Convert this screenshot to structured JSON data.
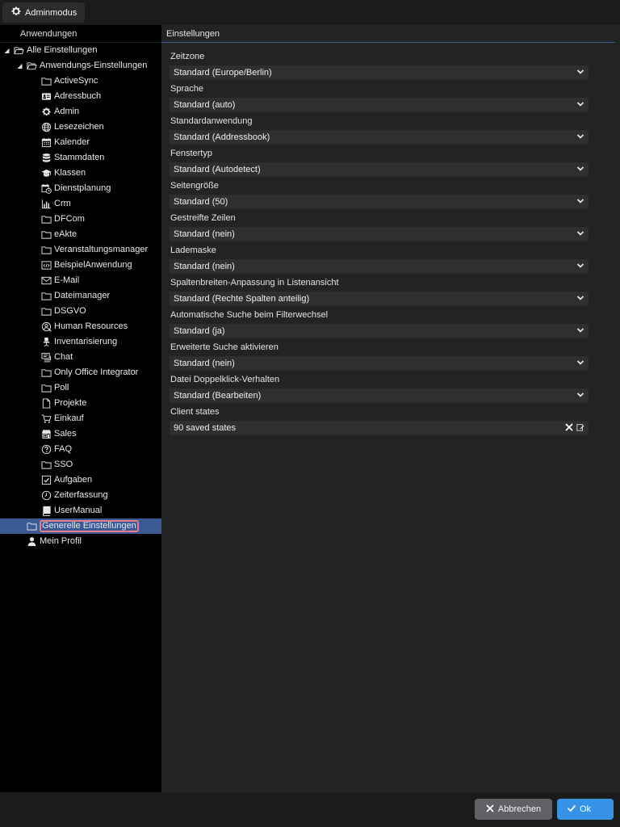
{
  "topbar": {
    "admin_label": "Adminmodus"
  },
  "left": {
    "header": "Anwendungen",
    "tree": [
      {
        "label": "Alle Einstellungen",
        "level": 0,
        "toggle": "expanded",
        "icon": "folder-open-icon"
      },
      {
        "label": "Anwendungs-Einstellungen",
        "level": 1,
        "toggle": "expanded",
        "icon": "folder-open-icon"
      },
      {
        "label": "ActiveSync",
        "level": 2,
        "icon": "folder-icon"
      },
      {
        "label": "Adressbuch",
        "level": 2,
        "icon": "address-card-icon"
      },
      {
        "label": "Admin",
        "level": 2,
        "icon": "gear-icon"
      },
      {
        "label": "Lesezeichen",
        "level": 2,
        "icon": "globe-icon"
      },
      {
        "label": "Kalender",
        "level": 2,
        "icon": "calendar-icon"
      },
      {
        "label": "Stammdaten",
        "level": 2,
        "icon": "database-icon"
      },
      {
        "label": "Klassen",
        "level": 2,
        "icon": "graduation-cap-icon"
      },
      {
        "label": "Dienstplanung",
        "level": 2,
        "icon": "calendar-clock-icon"
      },
      {
        "label": "Crm",
        "level": 2,
        "icon": "bar-chart-icon"
      },
      {
        "label": "DFCom",
        "level": 2,
        "icon": "folder-icon"
      },
      {
        "label": "eAkte",
        "level": 2,
        "icon": "folder-icon"
      },
      {
        "label": "Veranstaltungsmanager",
        "level": 2,
        "icon": "folder-icon"
      },
      {
        "label": "BeispielAnwendung",
        "level": 2,
        "icon": "code-window-icon"
      },
      {
        "label": "E-Mail",
        "level": 2,
        "icon": "envelope-icon"
      },
      {
        "label": "Dateimanager",
        "level": 2,
        "icon": "folder-icon"
      },
      {
        "label": "DSGVO",
        "level": 2,
        "icon": "folder-icon"
      },
      {
        "label": "Human Resources",
        "level": 2,
        "icon": "user-search-icon"
      },
      {
        "label": "Inventarisierung",
        "level": 2,
        "icon": "office-chair-icon"
      },
      {
        "label": "Chat",
        "level": 2,
        "icon": "chat-icon"
      },
      {
        "label": "Only Office Integrator",
        "level": 2,
        "icon": "folder-icon"
      },
      {
        "label": "Poll",
        "level": 2,
        "icon": "folder-icon"
      },
      {
        "label": "Projekte",
        "level": 2,
        "icon": "document-icon"
      },
      {
        "label": "Einkauf",
        "level": 2,
        "icon": "shopping-cart-icon"
      },
      {
        "label": "Sales",
        "level": 2,
        "icon": "store-icon"
      },
      {
        "label": "FAQ",
        "level": 2,
        "icon": "question-circle-icon"
      },
      {
        "label": "SSO",
        "level": 2,
        "icon": "folder-icon"
      },
      {
        "label": "Aufgaben",
        "level": 2,
        "icon": "checkbox-icon"
      },
      {
        "label": "Zeiterfassung",
        "level": 2,
        "icon": "clock-icon"
      },
      {
        "label": "UserManual",
        "level": 2,
        "icon": "book-icon"
      },
      {
        "label": "Generelle Einstellungen",
        "level": 1,
        "icon": "folder-icon",
        "selected": true
      },
      {
        "label": "Mein Profil",
        "level": 1,
        "icon": "user-icon"
      }
    ]
  },
  "right": {
    "header": "Einstellungen",
    "fields": [
      {
        "label": "Zeitzone",
        "value": "Standard (Europe/Berlin)"
      },
      {
        "label": "Sprache",
        "value": "Standard (auto)"
      },
      {
        "label": "Standardanwendung",
        "value": "Standard (Addressbook)"
      },
      {
        "label": "Fenstertyp",
        "value": "Standard (Autodetect)"
      },
      {
        "label": "Seitengröße",
        "value": "Standard (50)"
      },
      {
        "label": "Gestreifte Zeilen",
        "value": "Standard (nein)"
      },
      {
        "label": "Lademaske",
        "value": "Standard (nein)"
      },
      {
        "label": "Spaltenbreiten-Anpassung in Listenansicht",
        "value": "Standard (Rechte Spalten anteilig)"
      },
      {
        "label": "Automatische Suche beim Filterwechsel",
        "value": "Standard (ja)"
      },
      {
        "label": "Erweiterte Suche aktivieren",
        "value": "Standard (nein)"
      },
      {
        "label": "Datei Doppelklick-Verhalten",
        "value": "Standard (Bearbeiten)"
      }
    ],
    "client_states": {
      "label": "Client states",
      "value": "90 saved states"
    }
  },
  "footer": {
    "cancel_label": "Abbrechen",
    "ok_label": "Ok"
  },
  "colors": {
    "accent": "#3592e6",
    "selection": "#3b5a94",
    "highlight": "#e57c8a"
  }
}
